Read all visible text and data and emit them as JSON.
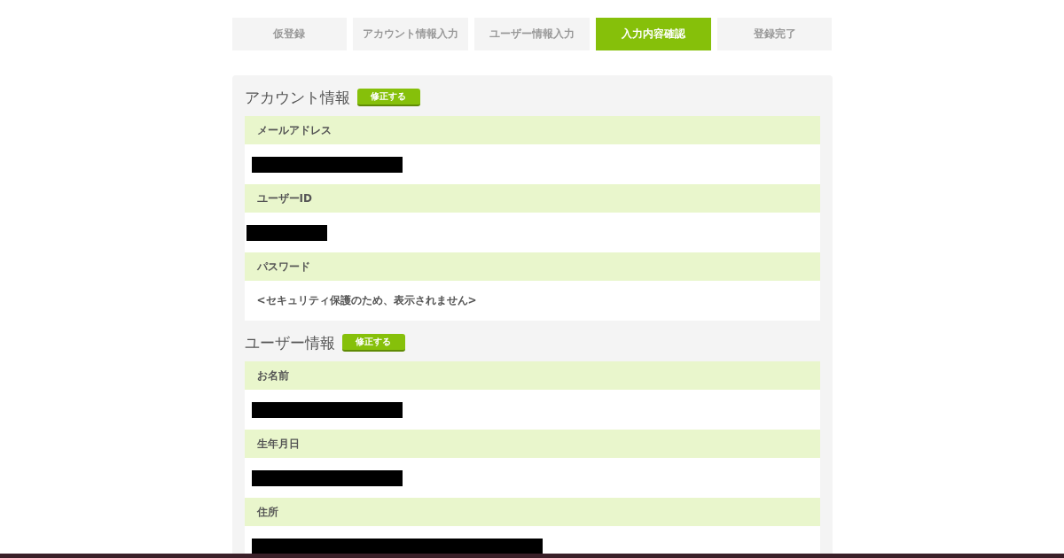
{
  "steps": [
    {
      "label": "仮登録",
      "selected": false
    },
    {
      "label": "アカウント情報入力",
      "selected": false
    },
    {
      "label": "ユーザー情報入力",
      "selected": false
    },
    {
      "label": "入力内容確認",
      "selected": true
    },
    {
      "label": "登録完了",
      "selected": false
    }
  ],
  "sections": [
    {
      "title": "アカウント情報",
      "edit_button": "修正する",
      "fields": [
        {
          "label": "メールアドレス",
          "value": {
            "kind": "redacted"
          }
        },
        {
          "label": "ユーザーID",
          "value": {
            "kind": "redacted"
          }
        },
        {
          "label": "パスワード",
          "value": {
            "kind": "text",
            "text": "<セキュリティ保護のため、表示されません>"
          }
        }
      ]
    },
    {
      "title": "ユーザー情報",
      "edit_button": "修正する",
      "fields": [
        {
          "label": "お名前",
          "value": {
            "kind": "redacted"
          }
        },
        {
          "label": "生年月日",
          "value": {
            "kind": "redacted"
          }
        },
        {
          "label": "住所",
          "value": {
            "kind": "redacted"
          }
        }
      ]
    }
  ]
}
